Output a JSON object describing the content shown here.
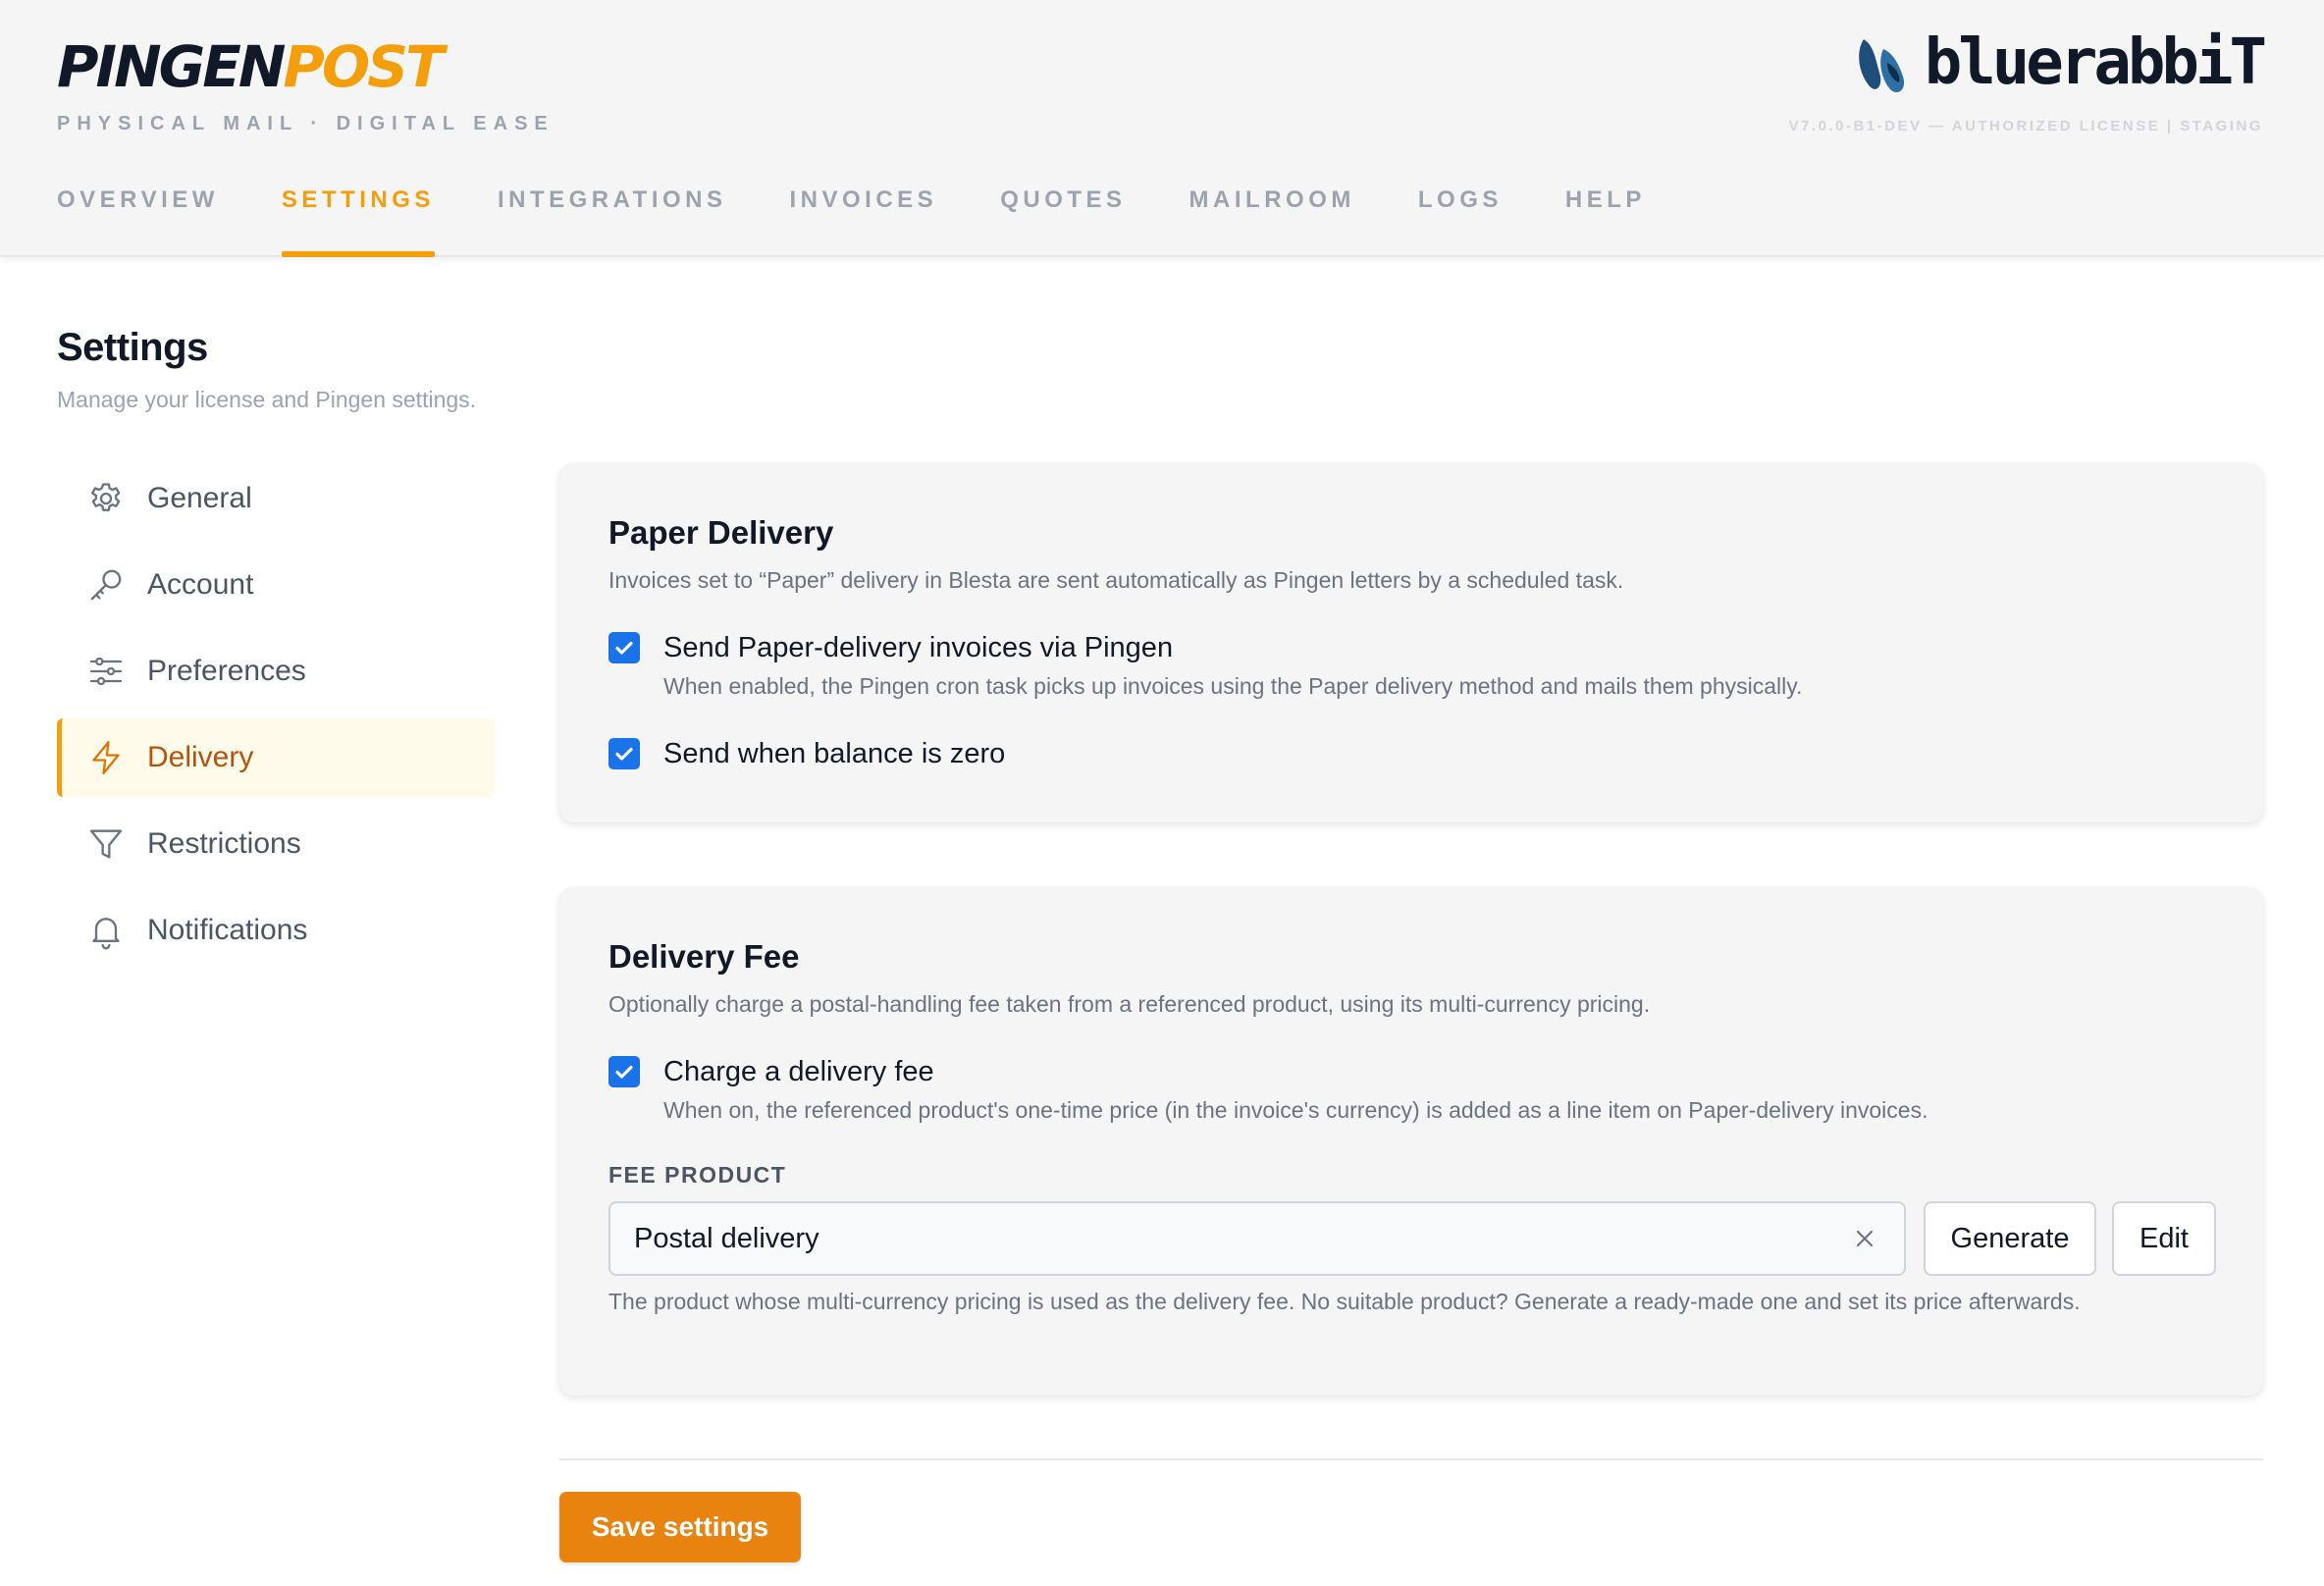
{
  "header": {
    "brand_part1": "PINGEN",
    "brand_part2": "POST",
    "tagline": "PHYSICAL MAIL · DIGITAL EASE",
    "logo_text": "bluerabbiT",
    "version": "V7.0.0-B1-DEV — AUTHORIZED LICENSE   | STAGING",
    "nav": [
      {
        "label": "OVERVIEW",
        "active": false
      },
      {
        "label": "SETTINGS",
        "active": true
      },
      {
        "label": "INTEGRATIONS",
        "active": false
      },
      {
        "label": "INVOICES",
        "active": false
      },
      {
        "label": "QUOTES",
        "active": false
      },
      {
        "label": "MAILROOM",
        "active": false
      },
      {
        "label": "LOGS",
        "active": false
      },
      {
        "label": "HELP",
        "active": false
      }
    ]
  },
  "page": {
    "title": "Settings",
    "subtitle": "Manage your license and Pingen settings."
  },
  "sidebar": {
    "items": [
      {
        "label": "General",
        "icon": "gear-icon"
      },
      {
        "label": "Account",
        "icon": "key-icon"
      },
      {
        "label": "Preferences",
        "icon": "sliders-icon"
      },
      {
        "label": "Delivery",
        "icon": "lightning-icon",
        "active": true
      },
      {
        "label": "Restrictions",
        "icon": "filter-icon"
      },
      {
        "label": "Notifications",
        "icon": "bell-icon"
      }
    ]
  },
  "paper_delivery": {
    "title": "Paper Delivery",
    "description": "Invoices set to “Paper” delivery in Blesta are sent automatically as Pingen letters by a scheduled task.",
    "send_via_pingen": {
      "label": "Send Paper-delivery invoices via Pingen",
      "help": "When enabled, the Pingen cron task picks up invoices using the Paper delivery method and mails them physically.",
      "checked": true
    },
    "send_zero_balance": {
      "label": "Send when balance is zero",
      "checked": true
    }
  },
  "delivery_fee": {
    "title": "Delivery Fee",
    "description": "Optionally charge a postal-handling fee taken from a referenced product, using its multi-currency pricing.",
    "charge_fee": {
      "label": "Charge a delivery fee",
      "help": "When on, the referenced product's one-time price (in the invoice's currency) is added as a line item on Paper-delivery invoices.",
      "checked": true
    },
    "fee_product_label": "FEE PRODUCT",
    "fee_product_value": "Postal delivery",
    "generate_label": "Generate",
    "edit_label": "Edit",
    "fee_product_help": "The product whose multi-currency pricing is used as the delivery fee. No suitable product? Generate a ready-made one and set its price afterwards."
  },
  "footer": {
    "save_label": "Save settings"
  },
  "colors": {
    "accent": "#f59e0b",
    "checkbox": "#1a73e8",
    "save_button": "#e8830f"
  }
}
